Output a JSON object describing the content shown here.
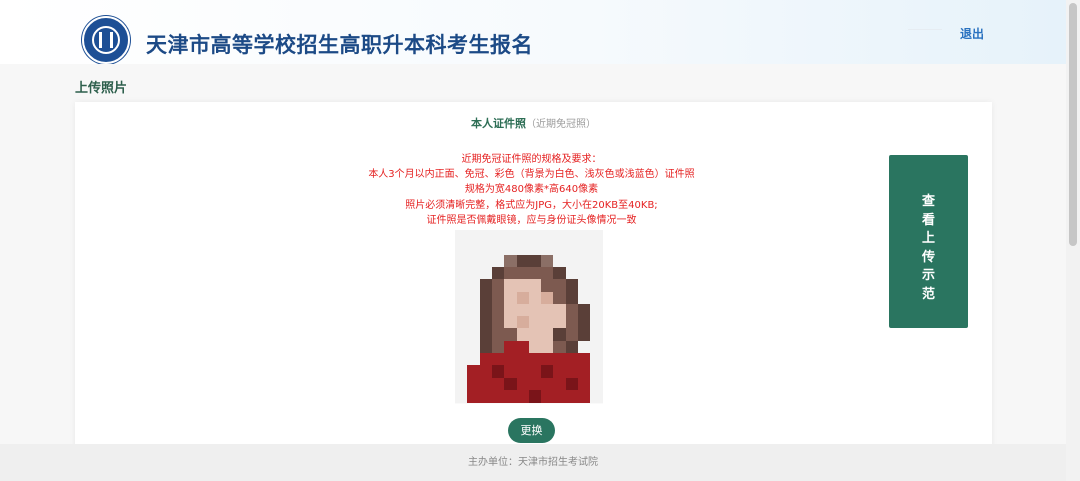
{
  "header": {
    "title": "天津市高等学校招生高职升本科考生报名",
    "logout_label": "退出"
  },
  "section": {
    "title": "上传照片"
  },
  "card": {
    "heading": "本人证件照",
    "subheading": "（近期免冠照）",
    "requirements": [
      "近期免冠证件照的规格及要求：",
      "本人3个月以内正面、免冠、彩色（背景为白色、浅灰色或浅蓝色）证件照",
      "规格为宽480像素*高640像素",
      "照片必须清晰完整，格式应为JPG，大小在20KB至40KB;",
      "证件照是否佩戴眼镜，应与身份证头像情况一致"
    ],
    "change_button_label": "更换",
    "demo_button_label": "查看上传示范"
  },
  "footer": {
    "text": "主办单位：天津市招生考试院"
  },
  "icons": {
    "logo": "university-seal-logo"
  },
  "colors": {
    "brand_blue": "#1c4a86",
    "accent_green": "#2a7560",
    "requirement_red": "#e52222",
    "link_blue": "#2a72c0"
  }
}
